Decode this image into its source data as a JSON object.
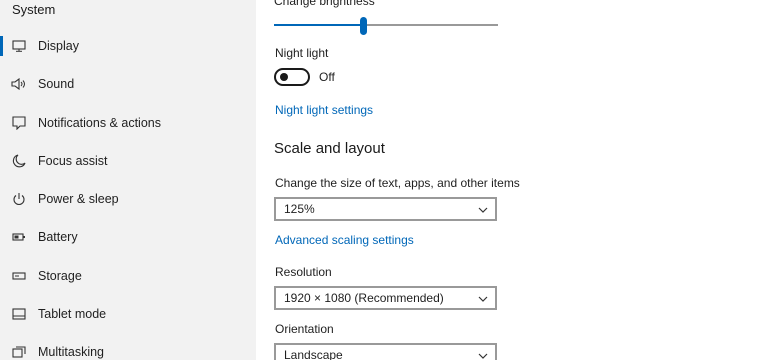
{
  "sidebar": {
    "title": "System",
    "items": [
      {
        "label": "Display",
        "icon": "monitor-icon",
        "selected": true
      },
      {
        "label": "Sound",
        "icon": "speaker-icon",
        "selected": false
      },
      {
        "label": "Notifications & actions",
        "icon": "notification-icon",
        "selected": false
      },
      {
        "label": "Focus assist",
        "icon": "moon-icon",
        "selected": false
      },
      {
        "label": "Power & sleep",
        "icon": "power-icon",
        "selected": false
      },
      {
        "label": "Battery",
        "icon": "battery-icon",
        "selected": false
      },
      {
        "label": "Storage",
        "icon": "storage-icon",
        "selected": false
      },
      {
        "label": "Tablet mode",
        "icon": "tablet-icon",
        "selected": false
      },
      {
        "label": "Multitasking",
        "icon": "multitasking-icon",
        "selected": false
      }
    ]
  },
  "main": {
    "brightness": {
      "label": "Change brightness",
      "level": 0.4
    },
    "night_light": {
      "label": "Night light",
      "state": "Off",
      "on": false,
      "settings_link": "Night light settings"
    },
    "scale_layout": {
      "heading": "Scale and layout",
      "size_label": "Change the size of text, apps, and other items",
      "size_value": "125%",
      "advanced_link": "Advanced scaling settings",
      "resolution_label": "Resolution",
      "resolution_value": "1920 × 1080 (Recommended)",
      "orientation_label": "Orientation",
      "orientation_value": "Landscape"
    }
  },
  "colors": {
    "accent": "#0067b8",
    "sidebar_bg": "#f2f2f2",
    "content_bg": "#ffffff"
  }
}
